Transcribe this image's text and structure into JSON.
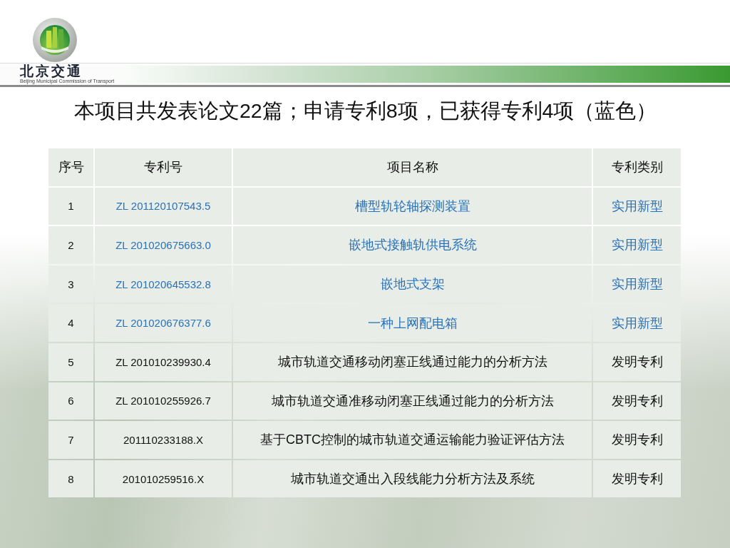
{
  "header": {
    "logo_text": "北京交通",
    "logo_subtitle": "Beijing Municipal Commission of Transport"
  },
  "title": "本项目共发表论文22篇；申请专利8项，已获得专利4项（蓝色）",
  "table": {
    "columns": [
      "序号",
      "专利号",
      "项目名称",
      "专利类别"
    ],
    "rows": [
      {
        "no": "1",
        "patent_no": "ZL 201120107543.5",
        "name": "槽型轨轮轴探测装置",
        "type": "实用新型",
        "granted": true
      },
      {
        "no": "2",
        "patent_no": "ZL 201020675663.0",
        "name": "嵌地式接触轨供电系统",
        "type": "实用新型",
        "granted": true
      },
      {
        "no": "3",
        "patent_no": "ZL 201020645532.8",
        "name": "嵌地式支架",
        "type": "实用新型",
        "granted": true
      },
      {
        "no": "4",
        "patent_no": "ZL 201020676377.6",
        "name": "一种上网配电箱",
        "type": "实用新型",
        "granted": true
      },
      {
        "no": "5",
        "patent_no": "ZL 201010239930.4",
        "name": "城市轨道交通移动闭塞正线通过能力的分析方法",
        "type": "发明专利",
        "granted": false
      },
      {
        "no": "6",
        "patent_no": "ZL 201010255926.7",
        "name": "城市轨道交通准移动闭塞正线通过能力的分析方法",
        "type": "发明专利",
        "granted": false
      },
      {
        "no": "7",
        "patent_no": "201110233188.X",
        "name": "基于CBTC控制的城市轨道交通运输能力验证评估方法",
        "type": "发明专利",
        "granted": false
      },
      {
        "no": "8",
        "patent_no": "201010259516.X",
        "name": "城市轨道交通出入段线能力分析方法及系统",
        "type": "发明专利",
        "granted": false
      }
    ]
  }
}
